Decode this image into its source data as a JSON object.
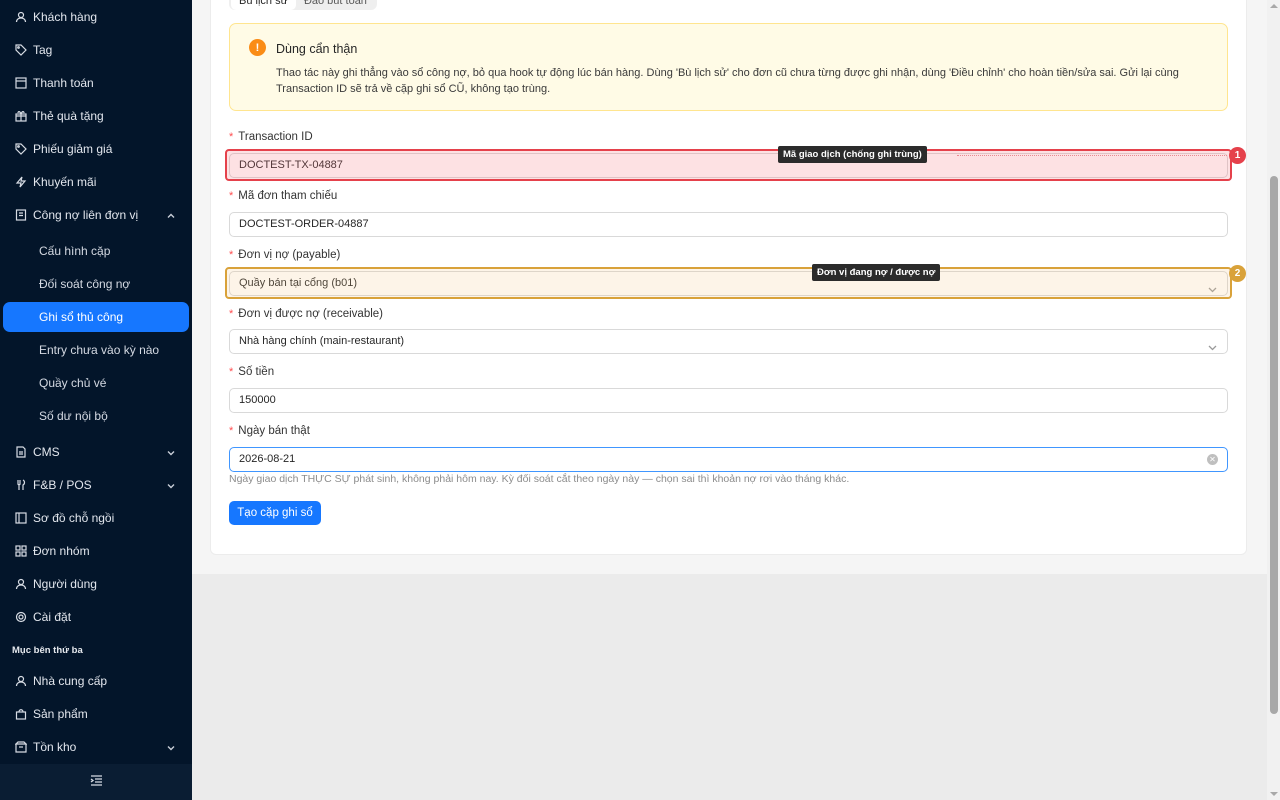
{
  "sidebar": {
    "items": [
      {
        "label": "Khách hàng",
        "icon": "user-icon"
      },
      {
        "label": "Tag",
        "icon": "tag-icon"
      },
      {
        "label": "Thanh toán",
        "icon": "payment-icon"
      },
      {
        "label": "Thẻ quà tặng",
        "icon": "gift-icon"
      },
      {
        "label": "Phiếu giảm giá",
        "icon": "coupon-icon"
      },
      {
        "label": "Khuyến mãi",
        "icon": "promotion-icon"
      },
      {
        "label": "Công nợ liên đơn vị",
        "icon": "ledger-icon"
      }
    ],
    "sub_items": [
      {
        "label": "Cấu hình cặp"
      },
      {
        "label": "Đối soát công nợ"
      },
      {
        "label": "Ghi sổ thủ công"
      },
      {
        "label": "Entry chưa vào kỳ nào"
      },
      {
        "label": "Quầy chủ vé"
      },
      {
        "label": "Số dư nội bộ"
      }
    ],
    "items2": [
      {
        "label": "CMS",
        "icon": "cms-icon"
      },
      {
        "label": "F&B / POS",
        "icon": "fnb-icon"
      },
      {
        "label": "Sơ đồ chỗ ngồi",
        "icon": "seat-map-icon"
      },
      {
        "label": "Đơn nhóm",
        "icon": "group-order-icon"
      },
      {
        "label": "Người dùng",
        "icon": "user-icon"
      },
      {
        "label": "Cài đặt",
        "icon": "gear-icon"
      }
    ],
    "section_title": "Mục bên thứ ba",
    "items3": [
      {
        "label": "Nhà cung cấp",
        "icon": "supplier-icon"
      },
      {
        "label": "Sản phẩm",
        "icon": "product-icon"
      },
      {
        "label": "Tồn kho",
        "icon": "inventory-icon"
      }
    ]
  },
  "tabs": [
    "Bù lịch sử",
    "Đảo bút toán"
  ],
  "alert": {
    "title": "Dùng cẩn thận",
    "description": "Thao tác này ghi thẳng vào sổ công nợ, bỏ qua hook tự động lúc bán hàng. Dùng 'Bù lịch sử' cho đơn cũ chưa từng được ghi nhận, dùng 'Điều chỉnh' cho hoàn tiền/sửa sai. Gửi lại cùng Transaction ID sẽ trả về cặp ghi sổ CŨ, không tạo trùng."
  },
  "form": {
    "transaction_id": {
      "label": "Transaction ID",
      "value": "DOCTEST-TX-04887"
    },
    "order_ref": {
      "label": "Mã đơn tham chiếu",
      "value": "DOCTEST-ORDER-04887"
    },
    "payable": {
      "label": "Đơn vị nợ (payable)",
      "value": "Quầy bán tại cổng (b01)"
    },
    "receivable": {
      "label": "Đơn vị được nợ (receivable)",
      "value": "Nhà hàng chính (main-restaurant)"
    },
    "amount": {
      "label": "Số tiền",
      "value": "150000"
    },
    "sale_date": {
      "label": "Ngày bán thật",
      "value": "2026-08-21"
    },
    "required_mark": "*",
    "hint": "Ngày giao dịch THỰC SỰ phát sinh, không phải hôm nay. Kỳ đối soát cắt theo ngày này — chọn sai thì khoản nợ rơi vào tháng khác.",
    "submit_label": "Tạo cặp ghi sổ"
  },
  "annotations": [
    {
      "number": "1",
      "text": "Mã giao dịch (chống ghi trùng)",
      "color": "#e5414b"
    },
    {
      "number": "2",
      "text": "Đơn vị đang nợ / được nợ",
      "color": "#d9a23a"
    }
  ]
}
